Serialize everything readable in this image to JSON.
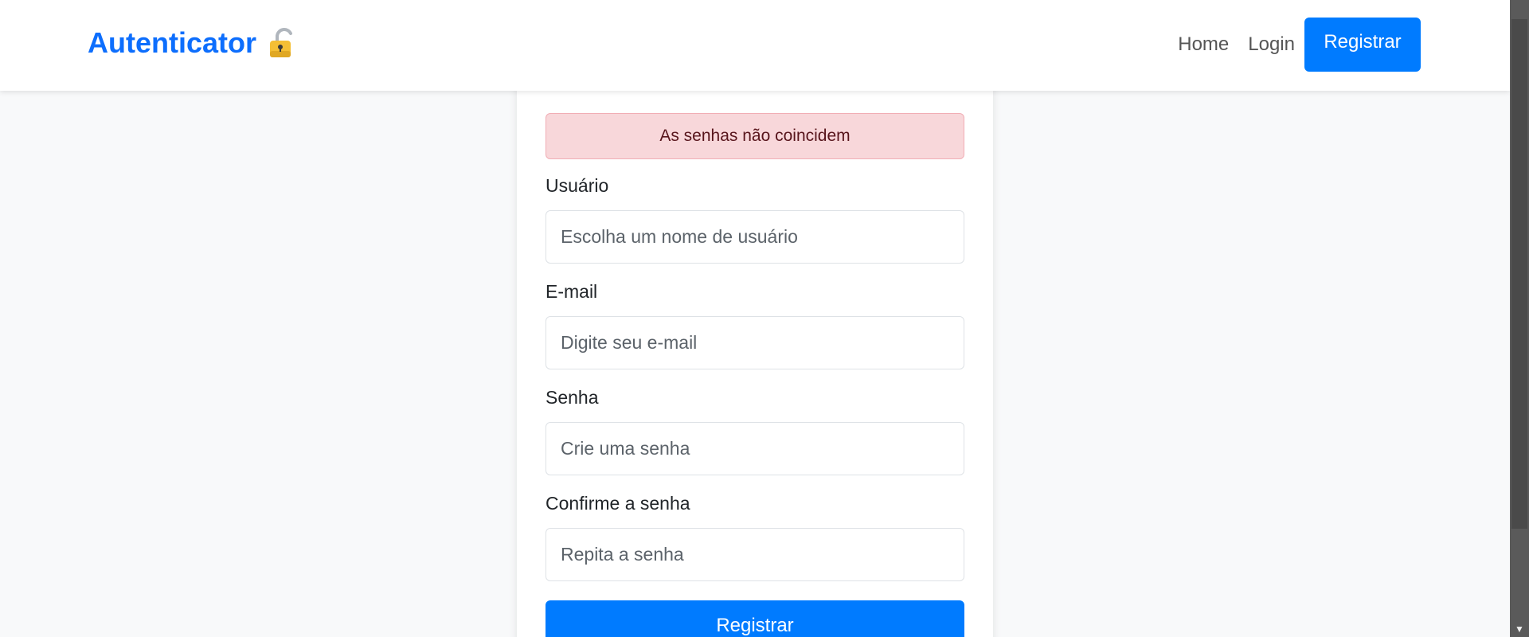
{
  "navbar": {
    "brand": "Autenticator",
    "brand_icon": "lock-icon",
    "links": {
      "home": "Home",
      "login": "Login",
      "register": "Registrar"
    }
  },
  "form": {
    "alert": "As senhas não coincidem",
    "username": {
      "label": "Usuário",
      "placeholder": "Escolha um nome de usuário"
    },
    "email": {
      "label": "E-mail",
      "placeholder": "Digite seu e-mail"
    },
    "password": {
      "label": "Senha",
      "placeholder": "Crie uma senha"
    },
    "confirm": {
      "label": "Confirme a senha",
      "placeholder": "Repita a senha"
    },
    "submit": "Registrar"
  },
  "colors": {
    "primary": "#007bff",
    "brand": "#0d6efd",
    "alert_bg": "#f8d7da",
    "alert_text": "#58151c",
    "page_bg": "#f8f9fa"
  }
}
